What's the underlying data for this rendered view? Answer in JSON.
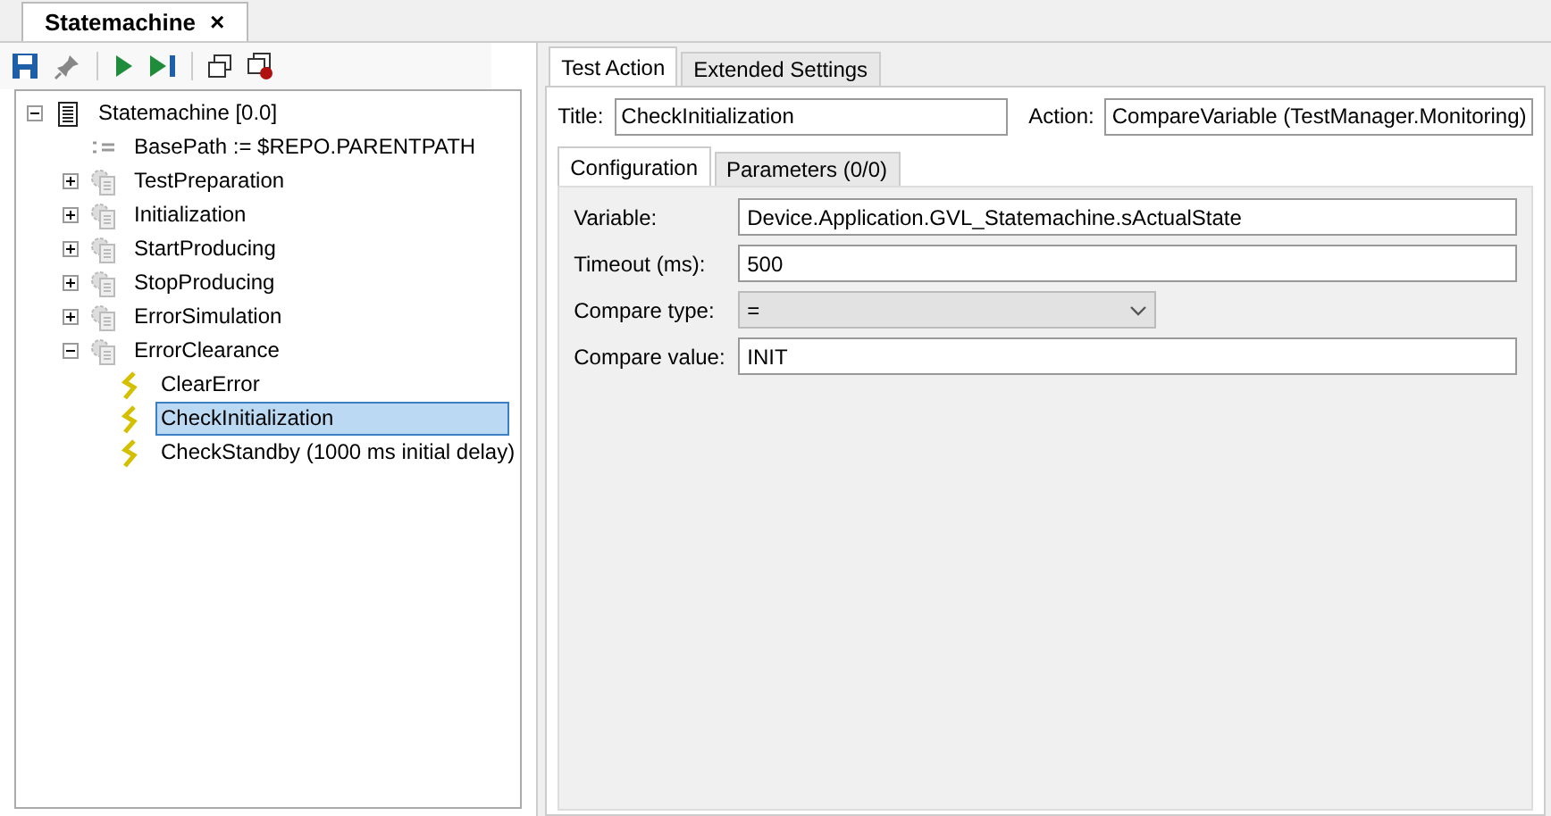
{
  "document_tab": {
    "label": "Statemachine",
    "close": "×",
    "selected": true
  },
  "tree": [
    {
      "kind": "root",
      "label": "Statemachine [0.0]",
      "expanded": true,
      "selected": false,
      "children": [
        {
          "kind": "variable",
          "label": "BasePath := $REPO.PARENTPATH",
          "selected": false
        },
        {
          "kind": "folder",
          "label": "TestPreparation",
          "expanded": false,
          "selected": false
        },
        {
          "kind": "folder",
          "label": "Initialization",
          "expanded": false,
          "selected": false
        },
        {
          "kind": "folder",
          "label": "StartProducing",
          "expanded": false,
          "selected": false
        },
        {
          "kind": "folder",
          "label": "StopProducing",
          "expanded": false,
          "selected": false
        },
        {
          "kind": "folder",
          "label": "ErrorSimulation",
          "expanded": false,
          "selected": false
        },
        {
          "kind": "folder",
          "label": "ErrorClearance",
          "expanded": true,
          "selected": false,
          "children": [
            {
              "kind": "action",
              "label": "ClearError",
              "selected": false
            },
            {
              "kind": "action",
              "label": "CheckInitialization",
              "selected": true
            },
            {
              "kind": "action",
              "label": "CheckStandby (1000 ms initial delay)",
              "selected": false
            }
          ]
        }
      ]
    }
  ],
  "tabs": [
    {
      "label": "Test Action",
      "selected": true
    },
    {
      "label": "Extended Settings",
      "selected": false
    }
  ],
  "title": {
    "label": "Title:",
    "value": "CheckInitialization"
  },
  "action": {
    "label": "Action:",
    "value": "CompareVariable (TestManager.Monitoring)"
  },
  "sub_tabs": [
    {
      "label": "Configuration",
      "selected": true
    },
    {
      "label": "Parameters (0/0)",
      "selected": false
    }
  ],
  "fields": [
    {
      "kind": "text",
      "label": "Variable:",
      "value": "Device.Application.GVL_Statemachine.sActualState"
    },
    {
      "kind": "text",
      "label": "Timeout (ms):",
      "value": "500"
    },
    {
      "kind": "select",
      "label": "Compare type:",
      "value": "="
    },
    {
      "kind": "text",
      "label": "Compare value:",
      "value": "INIT"
    }
  ]
}
